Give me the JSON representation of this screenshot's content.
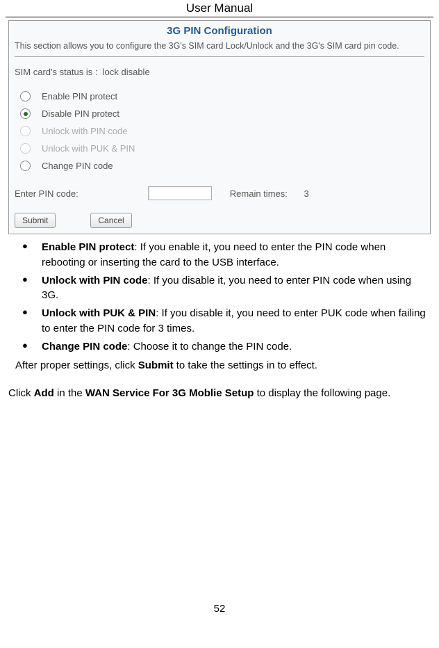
{
  "header": {
    "title": "User Manual"
  },
  "config": {
    "title": "3G PIN Configuration",
    "desc": "This section allows you to configure the 3G's SIM card Lock/Unlock and the 3G's SIM card pin code.",
    "status_label": "SIM card's status is :",
    "status_value": "lock disable",
    "options": {
      "enable": "Enable PIN protect",
      "disable": "Disable PIN protect",
      "unlock_pin": "Unlock with PIN code",
      "unlock_puk": "Unlock with PUK & PIN",
      "change": "Change PIN code"
    },
    "pin_label": "Enter PIN code:",
    "remain_label": "Remain times:",
    "remain_value": "3",
    "buttons": {
      "submit": "Submit",
      "cancel": "Cancel"
    }
  },
  "bullets": [
    {
      "title": "Enable PIN protect",
      "body": ": If you enable it, you need to enter the PIN code when rebooting or inserting the card to the USB interface."
    },
    {
      "title": "Unlock with PIN code",
      "body": ": If you disable it, you need to enter PIN code when using 3G."
    },
    {
      "title": "Unlock with PUK & PIN",
      "body": ": If you disable it, you need to enter PUK code when failing to enter the PIN code for 3 times."
    },
    {
      "title": "Change PIN code",
      "body": ": Choose it to change the PIN code."
    }
  ],
  "after": {
    "pre": "After proper settings, click ",
    "bold": "Submit",
    "post": " to take the settings in to effect."
  },
  "instruction": {
    "t1": "Click ",
    "b1": "Add",
    "t2": " in the ",
    "b2": "WAN Service For 3G Moblie Setup",
    "t3": " to display the following page."
  },
  "page_number": "52"
}
